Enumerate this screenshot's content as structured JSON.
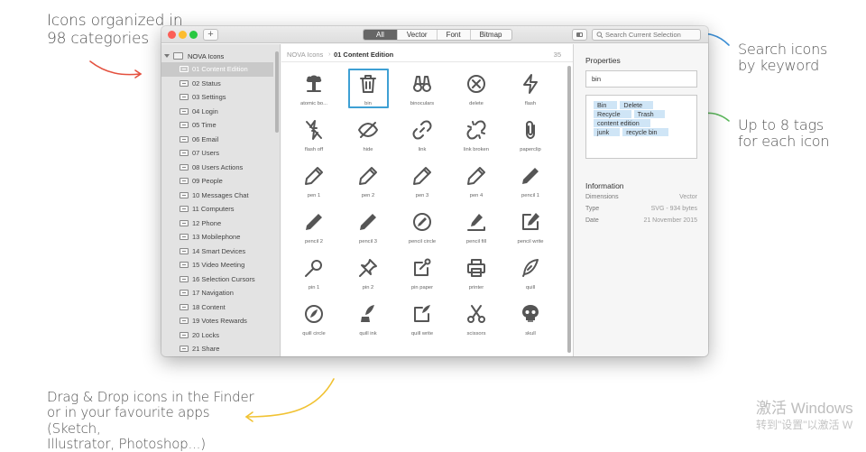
{
  "annotations": {
    "categories": [
      "Icons organized in",
      "98 categories"
    ],
    "search": [
      "Search icons",
      "by keyword"
    ],
    "tags": [
      "Up to 8 tags",
      "for each icon"
    ],
    "dragdrop": [
      "Drag & Drop icons in the Finder",
      "or in your favourite apps (Sketch,",
      "Illustrator, Photoshop...)"
    ]
  },
  "watermark": {
    "line1": "激活 Windows",
    "line2": "转到\"设置\"以激活 W"
  },
  "toolbar": {
    "add_label": "+",
    "segments": [
      {
        "label": "All",
        "active": true
      },
      {
        "label": "Vector",
        "active": false
      },
      {
        "label": "Font",
        "active": false
      },
      {
        "label": "Bitmap",
        "active": false
      }
    ],
    "search_placeholder": "Search Current Selection"
  },
  "sidebar": {
    "root": "NOVA Icons",
    "items": [
      "01 Content Edition",
      "02 Status",
      "03 Settings",
      "04 Login",
      "05 Time",
      "06 Email",
      "07 Users",
      "08 Users Actions",
      "09 People",
      "10 Messages Chat",
      "11 Computers",
      "12 Phone",
      "13 Mobilephone",
      "14 Smart Devices",
      "15 Video Meeting",
      "16 Selection Cursors",
      "17 Navigation",
      "18 Content",
      "19 Votes Rewards",
      "20 Locks",
      "21 Share"
    ],
    "active_index": 0
  },
  "main": {
    "breadcrumb_root": "NOVA Icons",
    "breadcrumb_sep": "›",
    "breadcrumb_current": "01 Content Edition",
    "count": "35",
    "icons": [
      {
        "label": "atomic bo...",
        "icon": "atomic-bomb-icon"
      },
      {
        "label": "bin",
        "icon": "bin-icon",
        "selected": true
      },
      {
        "label": "binoculars",
        "icon": "binoculars-icon"
      },
      {
        "label": "delete",
        "icon": "delete-icon"
      },
      {
        "label": "flash",
        "icon": "flash-icon"
      },
      {
        "label": "flash off",
        "icon": "flash-off-icon"
      },
      {
        "label": "hide",
        "icon": "hide-icon"
      },
      {
        "label": "link",
        "icon": "link-icon"
      },
      {
        "label": "link broken",
        "icon": "link-broken-icon"
      },
      {
        "label": "paperclip",
        "icon": "paperclip-icon"
      },
      {
        "label": "pen 1",
        "icon": "pen-icon"
      },
      {
        "label": "pen 2",
        "icon": "pen-icon"
      },
      {
        "label": "pen 3",
        "icon": "pen-icon"
      },
      {
        "label": "pen 4",
        "icon": "pen-icon"
      },
      {
        "label": "pencil 1",
        "icon": "pencil-icon"
      },
      {
        "label": "pencil 2",
        "icon": "pencil-icon"
      },
      {
        "label": "pencil 3",
        "icon": "pencil-icon"
      },
      {
        "label": "pencil circle",
        "icon": "pencil-circle-icon"
      },
      {
        "label": "pencil fill",
        "icon": "pencil-fill-icon"
      },
      {
        "label": "pencil write",
        "icon": "pencil-write-icon"
      },
      {
        "label": "pin 1",
        "icon": "pin-icon"
      },
      {
        "label": "pin 2",
        "icon": "pushpin-icon"
      },
      {
        "label": "pin paper",
        "icon": "pin-paper-icon"
      },
      {
        "label": "printer",
        "icon": "printer-icon"
      },
      {
        "label": "quill",
        "icon": "quill-icon"
      },
      {
        "label": "quill circle",
        "icon": "quill-circle-icon"
      },
      {
        "label": "quill ink",
        "icon": "quill-ink-icon"
      },
      {
        "label": "quill write",
        "icon": "quill-write-icon"
      },
      {
        "label": "scissors",
        "icon": "scissors-icon"
      },
      {
        "label": "skull",
        "icon": "skull-icon"
      }
    ]
  },
  "panel": {
    "properties_title": "Properties",
    "name_value": "bin",
    "tags": [
      [
        "Bin",
        "Delete"
      ],
      [
        "Recycle",
        "Trash"
      ],
      [
        "content edition"
      ],
      [
        "junk",
        "recycle bin"
      ]
    ],
    "information_title": "Information",
    "info": [
      {
        "key": "Dimensions",
        "value": "Vector"
      },
      {
        "key": "Type",
        "value": "SVG - 934 bytes"
      },
      {
        "key": "Date",
        "value": "21 November 2015"
      }
    ]
  },
  "colors": {
    "selection_border": "#3ea0d4",
    "tag_bg": "#cfe5f6",
    "arrow_red": "#e4513f",
    "arrow_blue": "#3b8fd6",
    "arrow_green": "#5cb85c",
    "arrow_yellow": "#f1c232"
  }
}
